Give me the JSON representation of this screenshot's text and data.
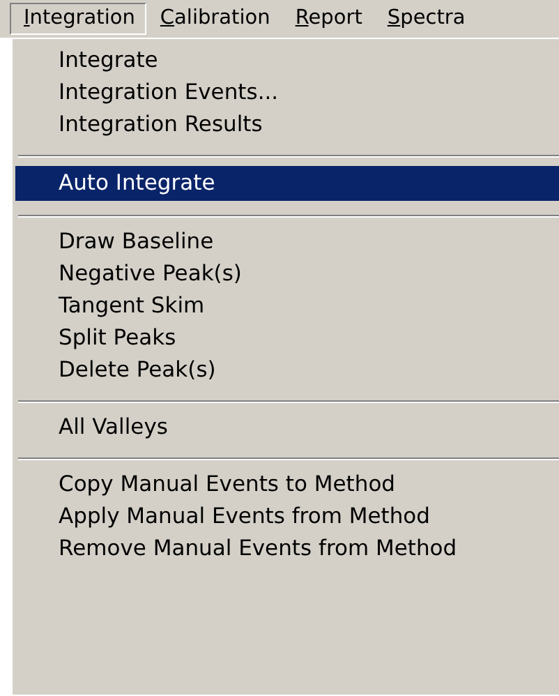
{
  "menu_bar": [
    {
      "mnemonic": "I",
      "rest": "ntegration",
      "selected": true
    },
    {
      "mnemonic": "C",
      "rest": "alibration",
      "selected": false
    },
    {
      "mnemonic": "R",
      "rest": "eport",
      "selected": false
    },
    {
      "mnemonic": "S",
      "rest": "pectra",
      "selected": false
    }
  ],
  "menu": {
    "items": [
      {
        "kind": "item",
        "label": "Integrate",
        "selected": false
      },
      {
        "kind": "item",
        "label": "Integration Events...",
        "selected": false
      },
      {
        "kind": "item",
        "label": "Integration Results",
        "selected": false
      },
      {
        "kind": "separator"
      },
      {
        "kind": "item",
        "label": "Auto Integrate",
        "selected": true
      },
      {
        "kind": "separator"
      },
      {
        "kind": "item",
        "label": "Draw Baseline",
        "selected": false
      },
      {
        "kind": "item",
        "label": "Negative Peak(s)",
        "selected": false
      },
      {
        "kind": "item",
        "label": "Tangent Skim",
        "selected": false
      },
      {
        "kind": "item",
        "label": "Split Peaks",
        "selected": false
      },
      {
        "kind": "item",
        "label": "Delete Peak(s)",
        "selected": false
      },
      {
        "kind": "separator"
      },
      {
        "kind": "item",
        "label": "All Valleys",
        "selected": false
      },
      {
        "kind": "separator"
      },
      {
        "kind": "item",
        "label": "Copy Manual Events to Method",
        "selected": false
      },
      {
        "kind": "item",
        "label": "Apply Manual Events from Method",
        "selected": false
      },
      {
        "kind": "item",
        "label": "Remove Manual Events from Method",
        "selected": false
      }
    ]
  }
}
